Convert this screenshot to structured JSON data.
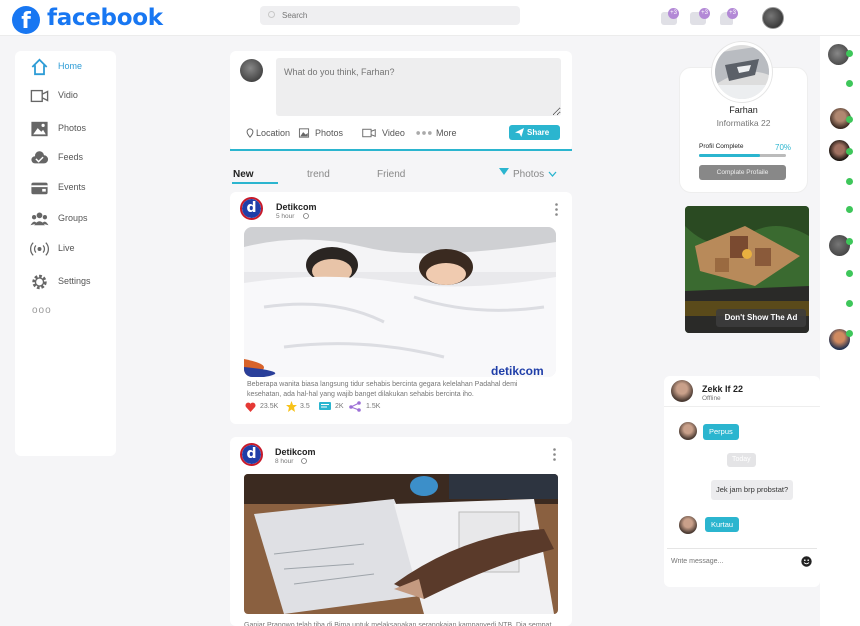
{
  "brand": {
    "logo_glyph": "f",
    "name": "facebook",
    "color": "#1877f2"
  },
  "accent_color": "#2bb5cf",
  "search": {
    "placeholder": "Search"
  },
  "top_icons": [
    {
      "icon": "user-add-icon",
      "badge": "+3"
    },
    {
      "icon": "chat-icon",
      "badge": "+3"
    },
    {
      "icon": "bell-icon",
      "badge": "+3"
    }
  ],
  "nav": {
    "items": [
      {
        "label": "Home",
        "icon": "home-icon",
        "active": true
      },
      {
        "label": "Vidio",
        "icon": "video-icon"
      },
      {
        "label": "Photos",
        "icon": "photos-icon"
      },
      {
        "label": "Feeds",
        "icon": "feeds-icon"
      },
      {
        "label": "Events",
        "icon": "events-icon"
      },
      {
        "label": "Groups",
        "icon": "groups-icon"
      },
      {
        "label": "Live",
        "icon": "live-icon"
      },
      {
        "label": "Settings",
        "icon": "settings-icon"
      }
    ],
    "more": "ooo"
  },
  "composer": {
    "placeholder": "What do you think, Farhan?",
    "actions": {
      "location": "Location",
      "photos": "Photos",
      "video": "Video",
      "more": "More"
    },
    "share": "Share"
  },
  "tabs": {
    "new": "New",
    "trend": "trend",
    "friend": "Friend",
    "filter": "Photos"
  },
  "posts": [
    {
      "author": "Detikcom",
      "time": "5 hour",
      "watermark": "detikcom",
      "text": "Beberapa wanita biasa langsung tidur sehabis bercinta gegara kelelahan Padahal demi kesehatan, ada hal-hal yang wajib banget dilakukan sehabis bercinta iho.",
      "likes": "23.5K",
      "rating": "3.5",
      "comments": "2K",
      "shares": "1.5K"
    },
    {
      "author": "Detikcom",
      "time": "8 hour",
      "text": "Ganjar Pranowo telah tiba di Bima untuk melaksanakan serangkaian kampanyedi NTB. Dia sempat"
    }
  ],
  "profile": {
    "name": "Farhan",
    "subtitle": "Informatika 22",
    "complete_label": "Profil Complete",
    "complete_pct": "70%",
    "complete_value": 0.7,
    "button": "Complate Profaile"
  },
  "ad": {
    "button": "Don't Show The Ad"
  },
  "chat": {
    "name": "Zekk If 22",
    "status": "Offline",
    "messages": [
      {
        "from": "them",
        "text": "Perpus"
      },
      {
        "from": "system",
        "text": "Today"
      },
      {
        "from": "me",
        "text": "Jek jam brp probstat?"
      },
      {
        "from": "them",
        "text": "Kurtau"
      }
    ],
    "input_placeholder": "Write message..."
  }
}
